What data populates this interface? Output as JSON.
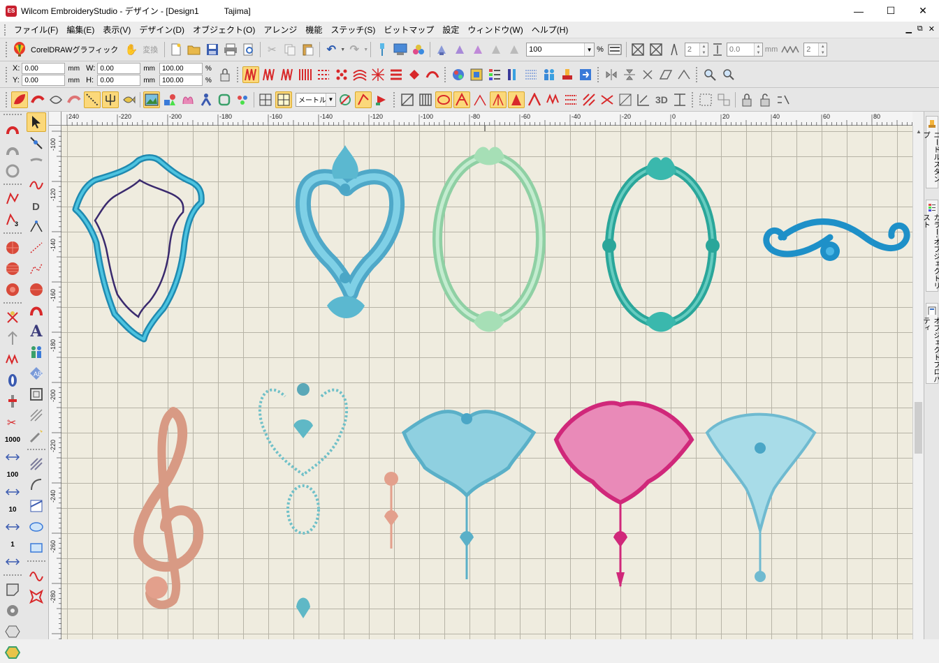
{
  "window": {
    "app_badge": "ES",
    "title": "Wilcom EmbroideryStudio - デザイン - [Design1",
    "machine": "Tajima]",
    "minimize": "—",
    "maximize": "☐",
    "close": "✕"
  },
  "menu": {
    "items": [
      "ファイル(F)",
      "編集(E)",
      "表示(V)",
      "デザイン(D)",
      "オブジェクト(O)",
      "アレンジ",
      "機能",
      "ステッチ(S)",
      "ビットマップ",
      "設定",
      "ウィンドウ(W)",
      "ヘルプ(H)"
    ],
    "mdi_controls": [
      "▁",
      "⧉",
      "✕"
    ]
  },
  "toolbar1": {
    "coreldraw_label": "CorelDRAWグラフィック",
    "convert_label": "変換",
    "zoom_value": "100",
    "zoom_unit": "%",
    "spin1": "2",
    "spin2": "0.0",
    "spin2_unit": "mm",
    "spin3": "2"
  },
  "toolbar2": {
    "x_label": "X:",
    "x_value": "0.00",
    "x_unit": "mm",
    "y_label": "Y:",
    "y_value": "0.00",
    "y_unit": "mm",
    "w_label": "W:",
    "w_value": "0.00",
    "w_unit": "mm",
    "h_label": "H:",
    "h_value": "0.00",
    "h_unit": "mm",
    "sw_value": "100.00",
    "sw_unit": "%",
    "sh_value": "100.00",
    "sh_unit": "%"
  },
  "toolbar3": {
    "method_select": "メートル法",
    "label_3d": "3D"
  },
  "left_toolbox": {
    "counter_1000": "1000",
    "counter_100": "100",
    "counter_10": "10",
    "counter_1": "1",
    "text_tool": "A"
  },
  "ruler": {
    "h_labels": [
      "240",
      "-220",
      "-200",
      "-180",
      "-160",
      "-140",
      "-120",
      "-100",
      "-80",
      "-60",
      "-40",
      "-20",
      "0",
      "20",
      "40",
      "60",
      "80"
    ],
    "v_labels": [
      "-100",
      "-120",
      "-140",
      "-160",
      "-180",
      "-200",
      "-220",
      "-240",
      "-260",
      "-280"
    ]
  },
  "right_dock": {
    "tabs": [
      "ニードルスタンプ",
      "カラー-オブジェクトリスト",
      "オブジェクトプロパティ"
    ]
  },
  "colors": {
    "teal_blue": "#2aa6c9",
    "light_aqua": "#6fc7d6",
    "mint": "#a7e0bb",
    "teal": "#3ab8ad",
    "pink": "#d0287a",
    "salmon": "#e3a08c",
    "purple_outline": "#3a2a6e"
  }
}
